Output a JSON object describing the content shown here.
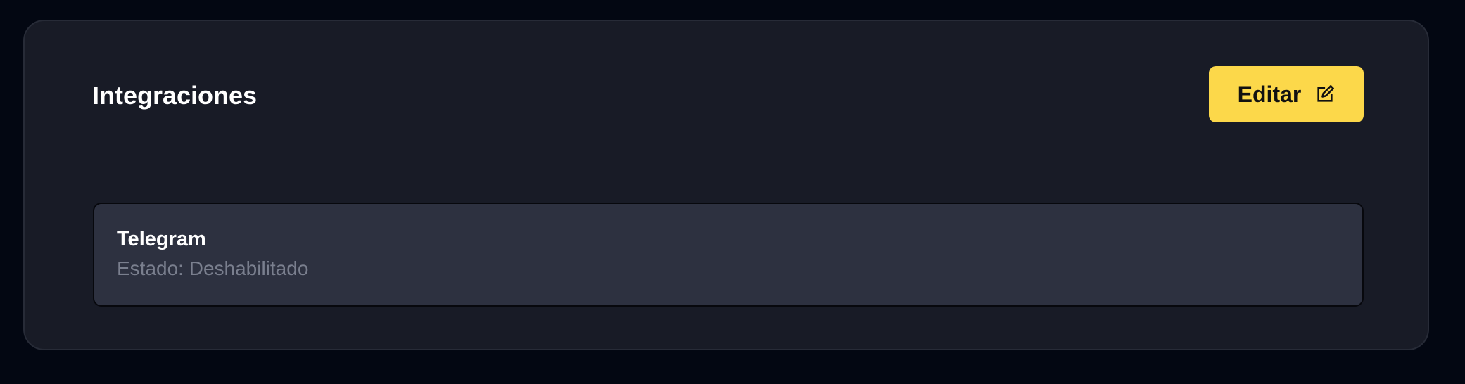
{
  "section": {
    "title": "Integraciones",
    "edit_label": "Editar",
    "edit_icon": "edit-icon"
  },
  "integrations": [
    {
      "name": "Telegram",
      "status_text": "Estado: Deshabilitado"
    }
  ],
  "colors": {
    "page_background": "#030712",
    "card_background": "#181b26",
    "accent_button": "#fcd84a",
    "item_background": "#2d3140",
    "muted_text": "#7a7f8e"
  }
}
